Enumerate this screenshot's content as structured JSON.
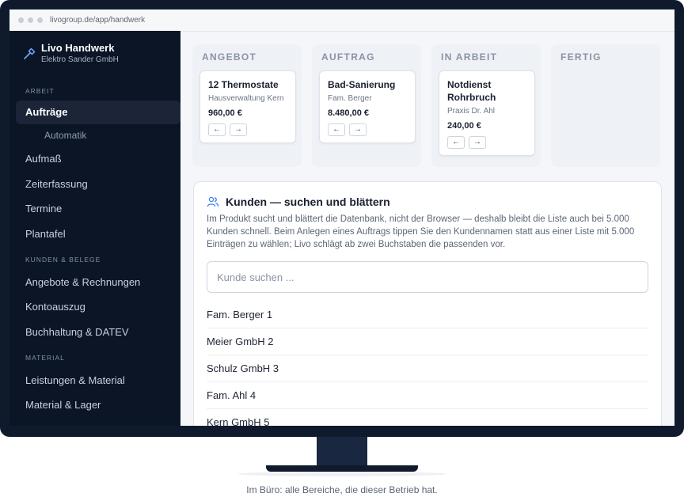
{
  "browser": {
    "url": "livogroup.de/app/handwerk"
  },
  "brand": {
    "name": "Livo Handwerk",
    "company": "Elektro Sander GmbH"
  },
  "sidebar": {
    "sections": [
      {
        "label": "ARBEIT"
      },
      {
        "label": "KUNDEN & BELEGE"
      },
      {
        "label": "MATERIAL"
      }
    ],
    "items": [
      {
        "label": "Aufträge"
      },
      {
        "label": "Automatik"
      },
      {
        "label": "Aufmaß"
      },
      {
        "label": "Zeiterfassung"
      },
      {
        "label": "Termine"
      },
      {
        "label": "Plantafel"
      },
      {
        "label": "Angebote & Rechnungen"
      },
      {
        "label": "Kontoauszug"
      },
      {
        "label": "Buchhaltung & DATEV"
      },
      {
        "label": "Leistungen & Material"
      },
      {
        "label": "Material & Lager"
      }
    ]
  },
  "board": {
    "columns": [
      {
        "title": "ANGEBOT",
        "card": {
          "title": "12 Thermostate",
          "customer": "Hausverwaltung Kern",
          "amount": "960,00 €"
        }
      },
      {
        "title": "AUFTRAG",
        "card": {
          "title": "Bad-Sanierung",
          "customer": "Fam. Berger",
          "amount": "8.480,00 €"
        }
      },
      {
        "title": "IN ARBEIT",
        "card": {
          "title": "Notdienst Rohrbruch",
          "customer": "Praxis Dr. Ahl",
          "amount": "240,00 €"
        }
      },
      {
        "title": "FERTIG"
      }
    ],
    "arrow_left": "←",
    "arrow_right": "→"
  },
  "customers": {
    "title": "Kunden — suchen und blättern",
    "description": "Im Produkt sucht und blättert die Datenbank, nicht der Browser — deshalb bleibt die Liste auch bei 5.000 Kunden schnell. Beim Anlegen eines Auftrags tippen Sie den Kundennamen statt aus einer Liste mit 5.000 Einträgen zu wählen; Livo schlägt ab zwei Buchstaben die passenden vor.",
    "search_placeholder": "Kunde suchen ...",
    "search_value": "",
    "list": [
      "Fam. Berger 1",
      "Meier GmbH 2",
      "Schulz GmbH 3",
      "Fam. Ahl 4",
      "Kern GmbH 5"
    ]
  },
  "caption": "Im Büro: alle Bereiche, die dieser Betrieb hat.",
  "colors": {
    "sidebar_bg": "#0b1526",
    "frame": "#0f1b2d",
    "accent": "#3b82f6"
  },
  "icons": {
    "brand": "hammer-icon",
    "customers": "users-icon"
  }
}
